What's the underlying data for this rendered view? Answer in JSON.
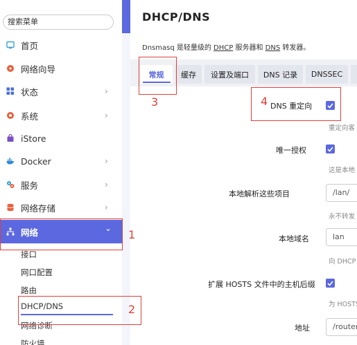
{
  "sidebar": {
    "search_placeholder": "搜索菜单",
    "items": [
      {
        "label": "首页",
        "icon": "monitor-icon",
        "chevron": ""
      },
      {
        "label": "网络向导",
        "icon": "compass-icon",
        "chevron": ""
      },
      {
        "label": "状态",
        "icon": "grid-icon",
        "chevron": "›"
      },
      {
        "label": "系统",
        "icon": "gear-icon",
        "chevron": "›"
      },
      {
        "label": "iStore",
        "icon": "store-icon",
        "chevron": ""
      },
      {
        "label": "Docker",
        "icon": "docker-icon",
        "chevron": "›"
      },
      {
        "label": "服务",
        "icon": "services-icon",
        "chevron": "›"
      },
      {
        "label": "网络存储",
        "icon": "storage-icon",
        "chevron": "›"
      },
      {
        "label": "网络",
        "icon": "network-icon",
        "chevron": "⌄"
      }
    ],
    "subitems": [
      "接口",
      "网口配置",
      "路由",
      "DHCP/DNS",
      "网络诊断",
      "防火墙"
    ]
  },
  "main": {
    "title": "DHCP/DNS",
    "desc_prefix": "Dnsmasq 是轻量级的 ",
    "desc_link1": "DHCP",
    "desc_mid": " 服务器和 ",
    "desc_link2": "DNS",
    "desc_suffix": " 转发器。",
    "tabs": [
      "常规",
      "缓存",
      "设置及端口",
      "DNS 记录",
      "DNSSEC"
    ],
    "fields": [
      {
        "label": "DNS 重定向",
        "hint": "重定向客"
      },
      {
        "label": "唯一授权",
        "hint": "这是本地"
      },
      {
        "label": "本地解析这些项目",
        "value": "/lan/",
        "hint": "永不转发"
      },
      {
        "label": "本地域名",
        "value": "lan",
        "hint": "向 DHCP"
      },
      {
        "label": "扩展 HOSTS 文件中的主机后缀",
        "hint": "为 HOSTS"
      },
      {
        "label": "地址",
        "value": "/router.l"
      }
    ]
  },
  "annotations": [
    "1",
    "2",
    "3",
    "4"
  ],
  "colors": {
    "accent": "#5b68df",
    "annotation": "#e0403a"
  }
}
